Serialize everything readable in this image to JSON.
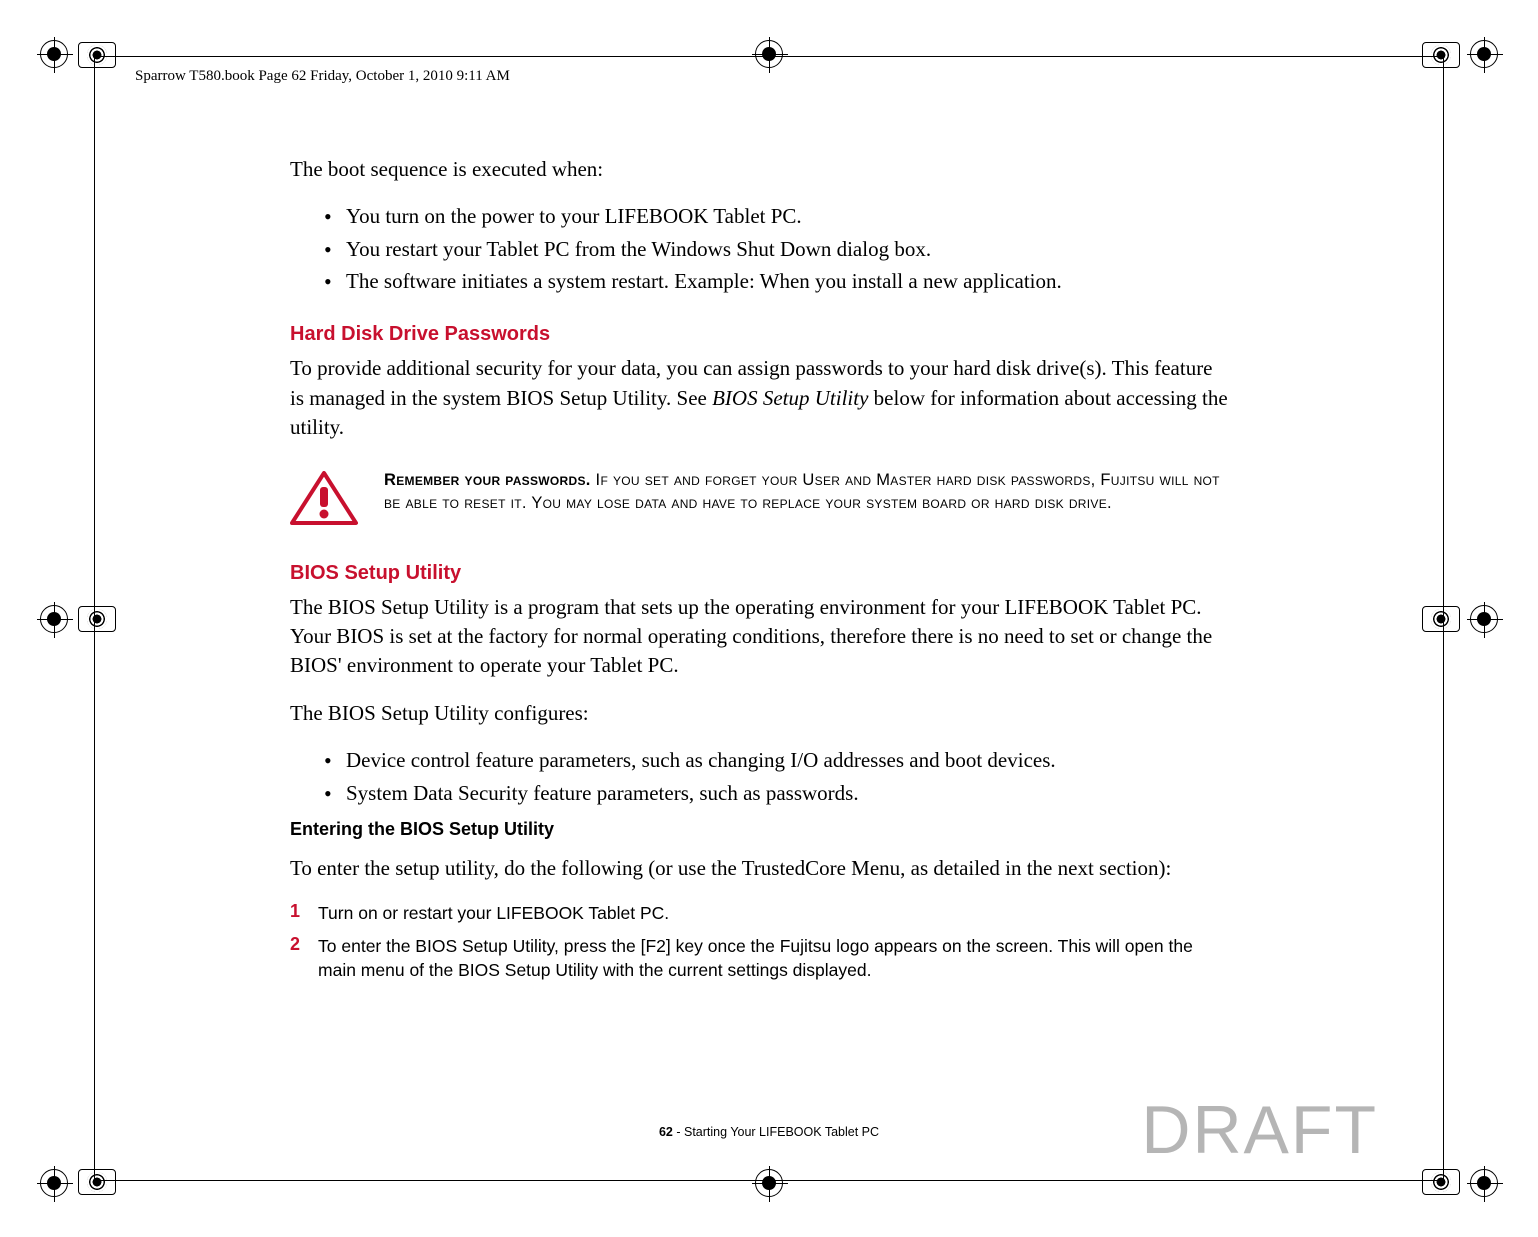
{
  "page_header": "Sparrow T580.book  Page 62  Friday, October 1, 2010  9:11 AM",
  "intro": "The boot sequence is executed when:",
  "boot_bullets": [
    "You turn on the power to your LIFEBOOK Tablet PC.",
    "You restart your Tablet PC from the Windows Shut Down dialog box.",
    "The software initiates a system restart. Example: When you install a new application."
  ],
  "sections": {
    "hdd": {
      "heading": "Hard Disk Drive Passwords",
      "para1_a": "To provide additional security for your data, you can assign passwords to your hard disk drive(s). This feature is managed in the system BIOS Setup Utility. See ",
      "para1_italic": "BIOS Setup Utility",
      "para1_b": " below for information about accessing the utility."
    },
    "warning": {
      "bold": "Remember your passwords.",
      "text": " If you set and forget your User and Master hard disk passwords, Fujitsu will not be able to reset it. You may lose data and have to replace your system board or hard disk drive."
    },
    "bios": {
      "heading": "BIOS Setup Utility",
      "para1": "The BIOS Setup Utility is a program that sets up the operating environment for your LIFEBOOK Tablet PC. Your BIOS is set at the factory for normal operating conditions, therefore there is no need to set or change the BIOS' environment to operate your Tablet PC.",
      "para2": "The BIOS Setup Utility configures:",
      "bullets": [
        "Device control feature parameters, such as changing I/O addresses and boot devices.",
        "System Data Security feature parameters, such as passwords."
      ],
      "subhead": "Entering the BIOS Setup Utility",
      "para3": "To enter the setup utility, do the following (or use the TrustedCore Menu, as detailed in the next section):",
      "steps": [
        {
          "num": "1",
          "text": "Turn on or restart your LIFEBOOK Tablet PC."
        },
        {
          "num": "2",
          "text": "To enter the BIOS Setup Utility, press the [F2] key once the Fujitsu logo appears on the screen. This will open the main menu of the BIOS Setup Utility with the current settings displayed."
        }
      ]
    }
  },
  "footer": {
    "page_num": "62",
    "title": " - Starting Your LIFEBOOK Tablet PC"
  },
  "watermark": "DRAFT",
  "colors": {
    "red": "#c8102e",
    "gray": "#b5b5b5"
  }
}
